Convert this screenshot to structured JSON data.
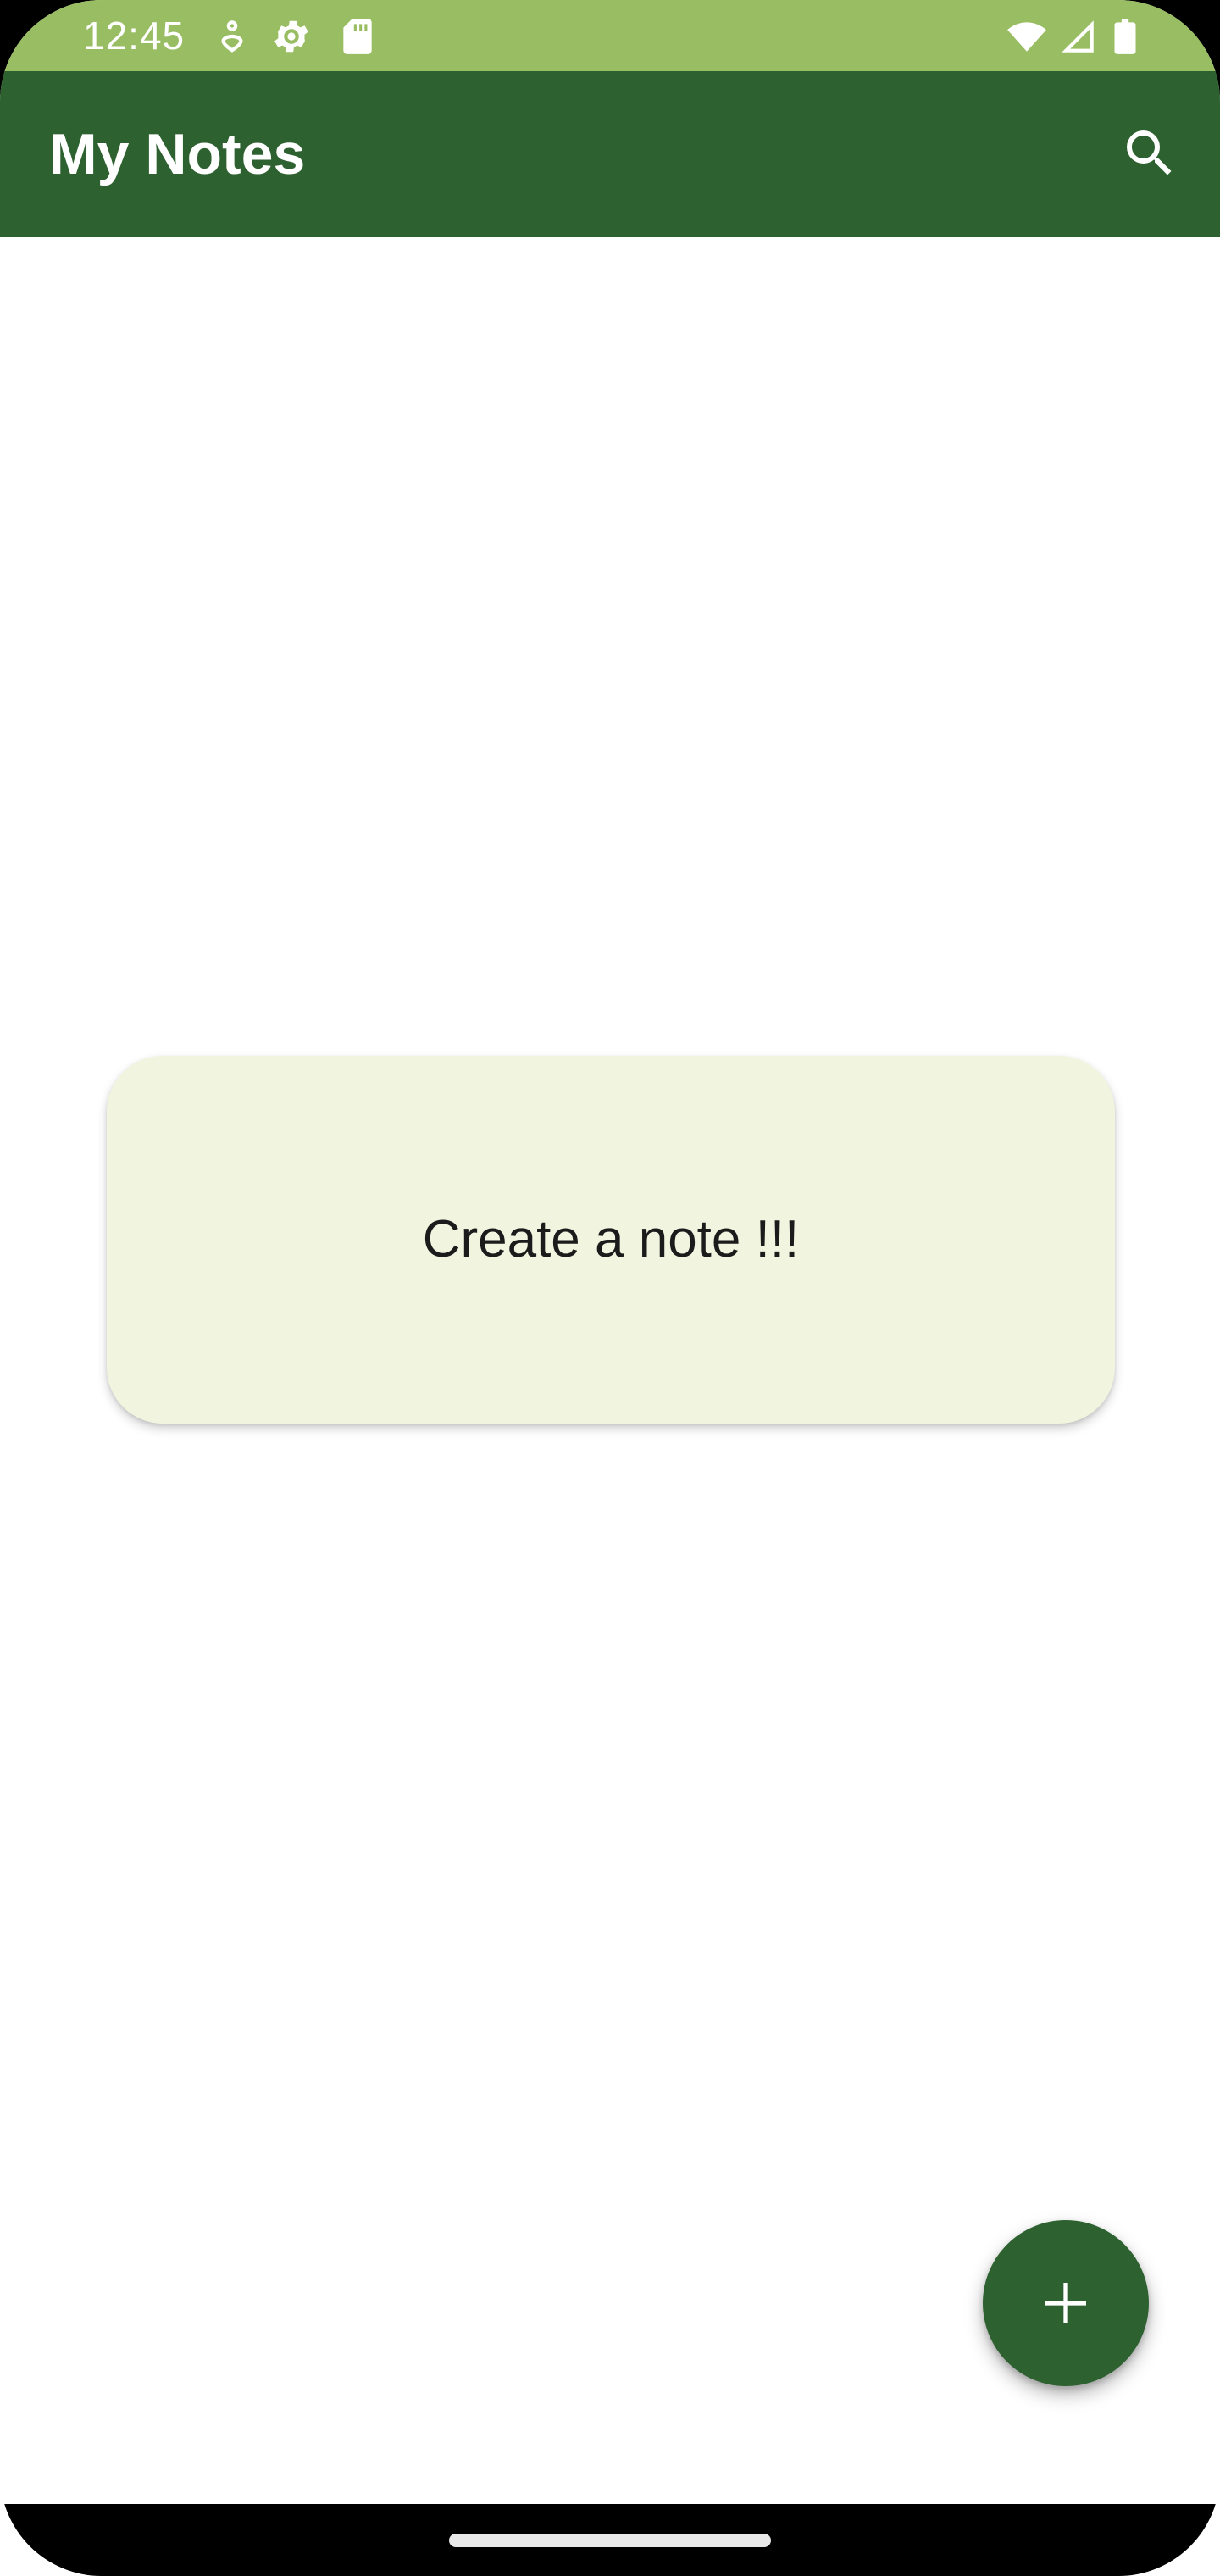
{
  "status_bar": {
    "time": "12:45",
    "icons_left": [
      "health-icon",
      "settings-gear-icon",
      "sd-card-icon"
    ],
    "icons_right": [
      "wifi-icon",
      "cellular-signal-icon",
      "battery-icon"
    ],
    "background": "#99bd62"
  },
  "app_bar": {
    "title": "My Notes",
    "action_icon": "search-icon",
    "background": "#2d6130"
  },
  "empty_state": {
    "message": "Create a note !!!",
    "background": "#f1f4df"
  },
  "fab": {
    "icon": "plus-icon",
    "background": "#2d6130"
  },
  "navigation": {
    "handle": "gesture-handle"
  }
}
